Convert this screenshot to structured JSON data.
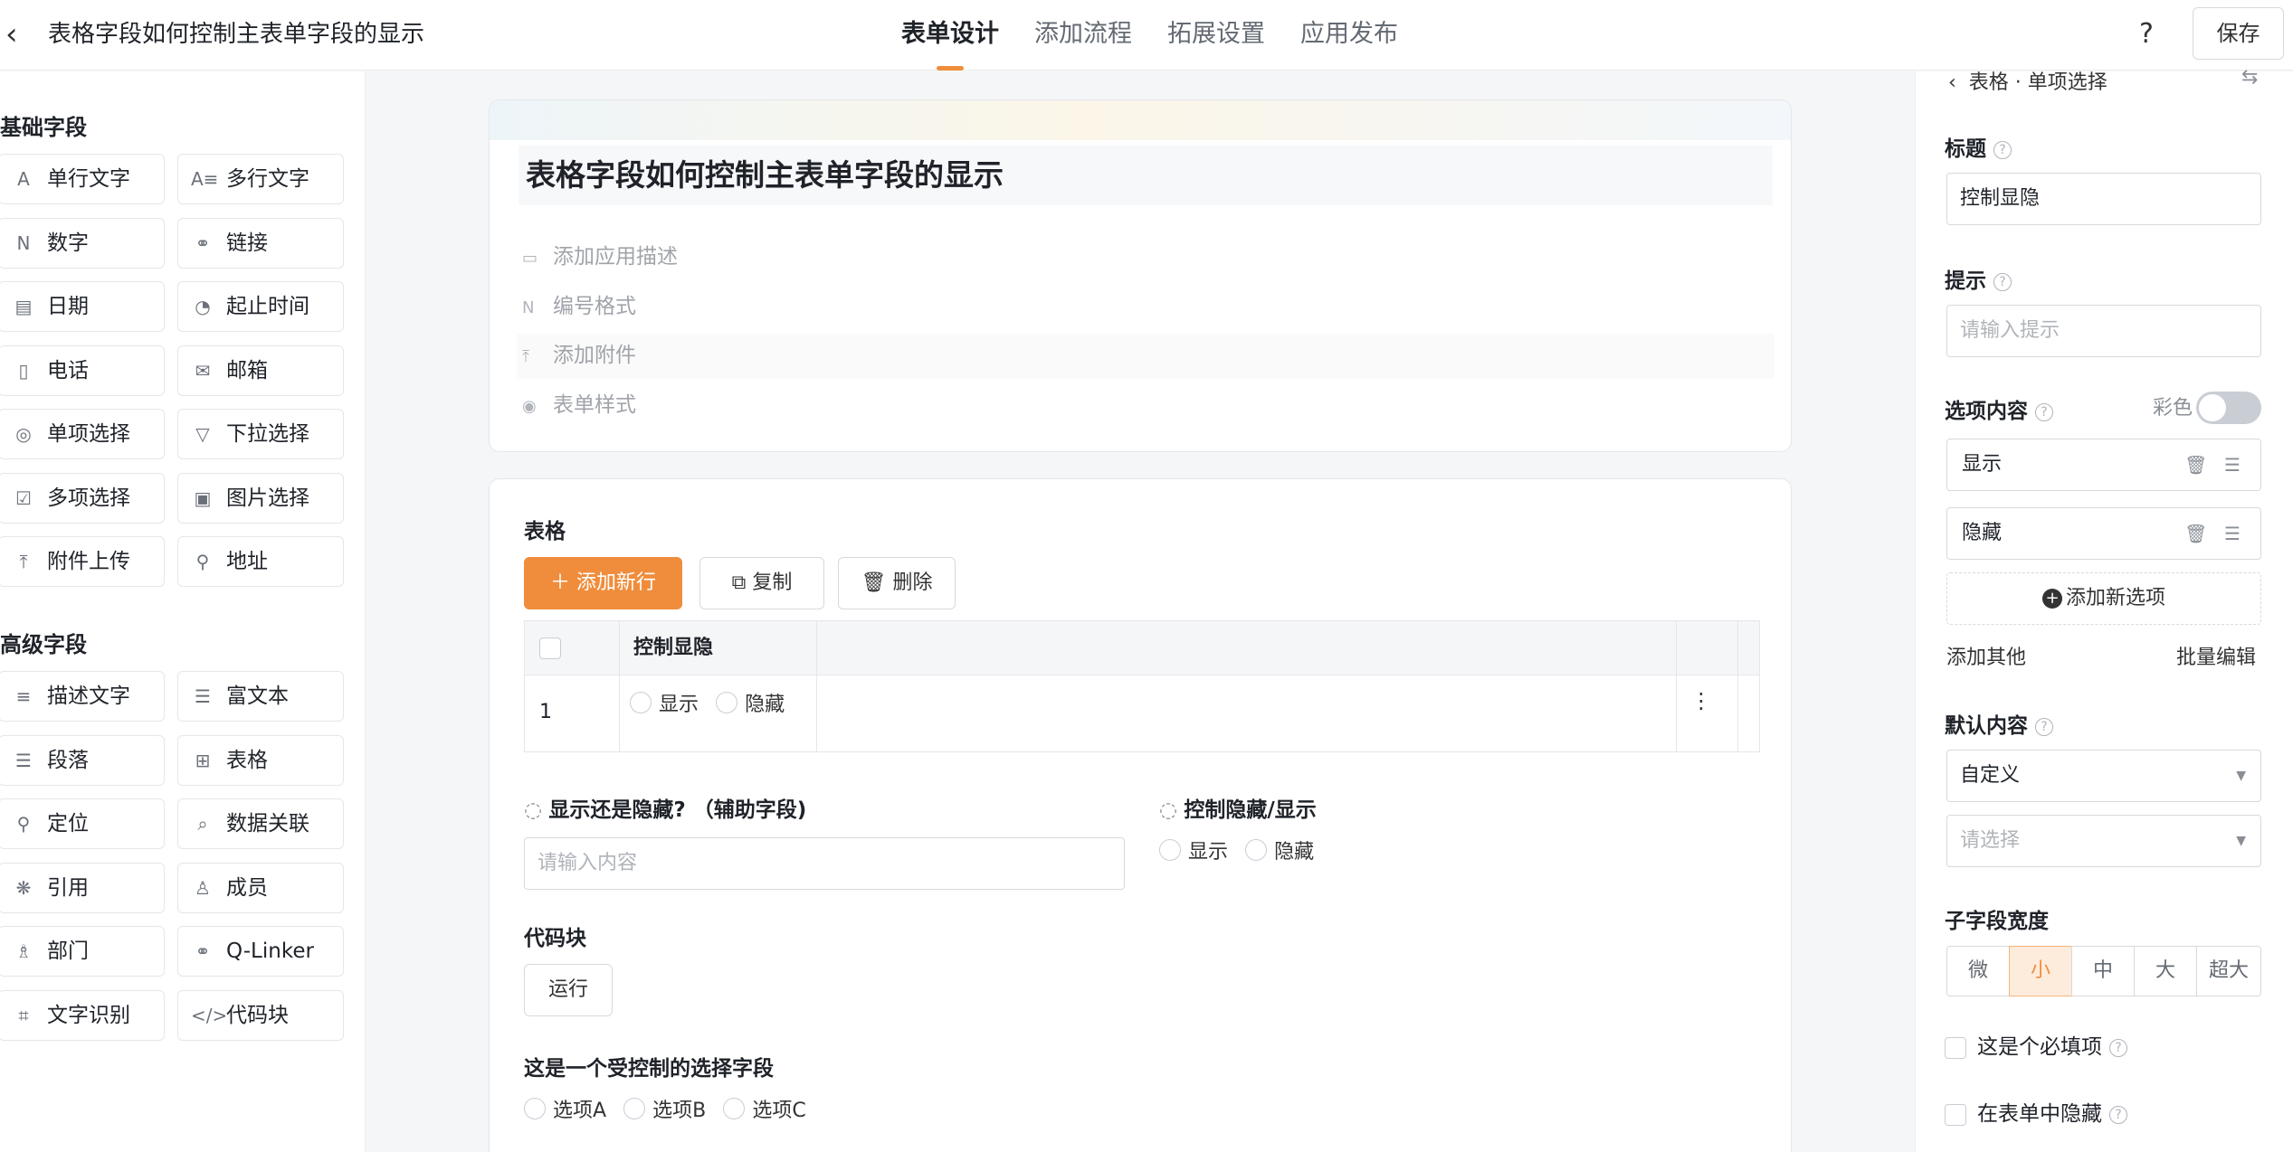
{
  "header": {
    "title": "表格字段如何控制主表单字段的显示",
    "tabs": [
      "表单设计",
      "添加流程",
      "拓展设置",
      "应用发布"
    ],
    "active_tab": "表单设计",
    "save_label": "保存",
    "help_glyph": "?"
  },
  "sidebar": {
    "basic_title": "基础字段",
    "basic_fields": [
      {
        "label": "单行文字",
        "icon": "single-line-text-icon",
        "glyph": "A"
      },
      {
        "label": "多行文字",
        "icon": "multi-line-text-icon",
        "glyph": "A≡"
      },
      {
        "label": "数字",
        "icon": "number-icon",
        "glyph": "N"
      },
      {
        "label": "链接",
        "icon": "link-icon",
        "glyph": "⚭"
      },
      {
        "label": "日期",
        "icon": "date-icon",
        "glyph": "▤"
      },
      {
        "label": "起止时间",
        "icon": "time-range-icon",
        "glyph": "◔"
      },
      {
        "label": "电话",
        "icon": "phone-icon",
        "glyph": "▯"
      },
      {
        "label": "邮箱",
        "icon": "mail-icon",
        "glyph": "✉"
      },
      {
        "label": "单项选择",
        "icon": "radio-icon",
        "glyph": "◎"
      },
      {
        "label": "下拉选择",
        "icon": "dropdown-icon",
        "glyph": "▽"
      },
      {
        "label": "多项选择",
        "icon": "checkbox-icon",
        "glyph": "☑"
      },
      {
        "label": "图片选择",
        "icon": "image-select-icon",
        "glyph": "▣"
      },
      {
        "label": "附件上传",
        "icon": "upload-icon",
        "glyph": "⤒"
      },
      {
        "label": "地址",
        "icon": "address-icon",
        "glyph": "⚲"
      }
    ],
    "advanced_title": "高级字段",
    "advanced_fields": [
      {
        "label": "描述文字",
        "icon": "description-icon",
        "glyph": "≡"
      },
      {
        "label": "富文本",
        "icon": "rich-text-icon",
        "glyph": "☰"
      },
      {
        "label": "段落",
        "icon": "paragraph-icon",
        "glyph": "☰"
      },
      {
        "label": "表格",
        "icon": "table-icon",
        "glyph": "⊞"
      },
      {
        "label": "定位",
        "icon": "location-icon",
        "glyph": "⚲"
      },
      {
        "label": "数据关联",
        "icon": "data-link-icon",
        "glyph": "⌕"
      },
      {
        "label": "引用",
        "icon": "reference-icon",
        "glyph": "❋"
      },
      {
        "label": "成员",
        "icon": "member-icon",
        "glyph": "♙"
      },
      {
        "label": "部门",
        "icon": "department-icon",
        "glyph": "♗"
      },
      {
        "label": "Q-Linker",
        "icon": "q-linker-icon",
        "glyph": "⚭"
      },
      {
        "label": "文字识别",
        "icon": "ocr-icon",
        "glyph": "⌗"
      },
      {
        "label": "代码块",
        "icon": "code-icon",
        "glyph": "</>"
      }
    ]
  },
  "form": {
    "title": "表格字段如何控制主表单字段的显示",
    "meta": [
      {
        "label": "添加应用描述",
        "icon": "comment-icon",
        "glyph": "▭"
      },
      {
        "label": "编号格式",
        "icon": "number-format-icon",
        "glyph": "N"
      },
      {
        "label": "添加附件",
        "icon": "attachment-upload-icon",
        "glyph": "⤒"
      },
      {
        "label": "表单样式",
        "icon": "palette-icon",
        "glyph": "◉"
      }
    ],
    "table_section": {
      "label": "表格",
      "add_row": "添加新行",
      "copy": "复制",
      "delete": "删除",
      "column": "控制显隐",
      "row_index": "1",
      "options": [
        "显示",
        "隐藏"
      ]
    },
    "aux_field": {
      "label": "显示还是隐藏? （辅助字段)",
      "placeholder": "请输入内容"
    },
    "control_field": {
      "label": "控制隐藏/显示",
      "options": [
        "显示",
        "隐藏"
      ]
    },
    "code_block": {
      "label": "代码块",
      "run": "运行"
    },
    "controlled_field": {
      "label": "这是一个受控制的选择字段",
      "options": [
        "选项A",
        "选项B",
        "选项C"
      ]
    }
  },
  "panel": {
    "breadcrumb": "表格 · 单项选择",
    "title_label": "标题",
    "title_value": "控制显隐",
    "hint_label": "提示",
    "hint_placeholder": "请输入提示",
    "options_label": "选项内容",
    "color_label": "彩色",
    "options": [
      "显示",
      "隐藏"
    ],
    "add_option": "添加新选项",
    "add_other": "添加其他",
    "batch_edit": "批量编辑",
    "default_label": "默认内容",
    "default_value": "自定义",
    "default_placeholder": "请选择",
    "width_label": "子字段宽度",
    "widths": [
      "微",
      "小",
      "中",
      "大",
      "超大"
    ],
    "selected_width": "小",
    "required_label": "这是个必填项",
    "hidden_label": "在表单中隐藏"
  },
  "colors": {
    "accent": "#f08d3c",
    "accent_light": "#fdecdc"
  }
}
